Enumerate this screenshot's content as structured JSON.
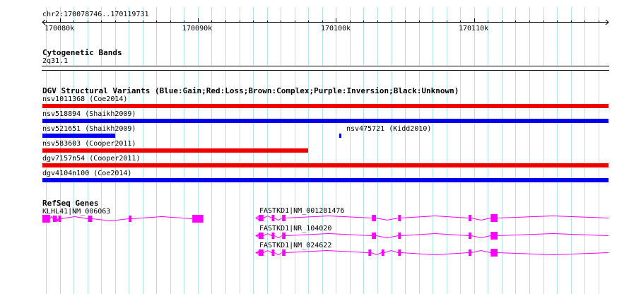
{
  "locus": "chr2:170078746..170119731",
  "ruler": {
    "start": 170078746,
    "end": 170119731,
    "ticks": [
      "170080k",
      "170090k",
      "170100k",
      "170110k"
    ],
    "tick_values": [
      170080000,
      170090000,
      170100000,
      170110000
    ]
  },
  "cytoband": {
    "title": "Cytogenetic Bands",
    "band": "2q31.1"
  },
  "dgv": {
    "title": "DGV Structural Variants (Blue:Gain;Red:Loss;Brown:Complex;Purple:Inversion;Black:Unknown)",
    "colors": {
      "gain": "#0000ee",
      "loss": "#ee0000"
    },
    "variants": [
      {
        "label": "nsv1011368 (Coe2014)",
        "type": "loss",
        "start": 170078746,
        "end": 170119731
      },
      {
        "label": "nsv518894 (Shaikh2009)",
        "type": "gain",
        "start": 170078746,
        "end": 170119731
      },
      {
        "label": "nsv521651 (Shaikh2009)",
        "type": "gain",
        "start": 170078746,
        "end": 170084000
      },
      {
        "label": "nsv475721 (Kidd2010)",
        "type": "gain",
        "start": 170100250,
        "end": 170100400
      },
      {
        "label": "nsv583603 (Cooper2011)",
        "type": "loss",
        "start": 170078746,
        "end": 170098000
      },
      {
        "label": "dgv7157n54 (Cooper2011)",
        "type": "loss",
        "start": 170078746,
        "end": 170119731
      },
      {
        "label": "dgv4104n100 (Coe2014)",
        "type": "gain",
        "start": 170078746,
        "end": 170119731
      }
    ]
  },
  "refseq": {
    "title": "RefSeq Genes",
    "color": "#ff00ff",
    "genes": [
      {
        "label": "KLHL41|NM_006063",
        "start": 170078746,
        "end": 170090400,
        "exons": [
          [
            170078746,
            170079300
          ],
          [
            170079500,
            170079800
          ],
          [
            170079900,
            170080100
          ],
          [
            170082050,
            170082350
          ],
          [
            170085000,
            170085200
          ],
          [
            170089600,
            170090400
          ]
        ]
      },
      {
        "label": "FASTKD1|NM_001281476",
        "start": 170094200,
        "end": 170119731,
        "exons": [
          [
            170094400,
            170094750
          ],
          [
            170095350,
            170095550
          ],
          [
            170096100,
            170096350
          ],
          [
            170102600,
            170102900
          ],
          [
            170104500,
            170104700
          ],
          [
            170109600,
            170109800
          ],
          [
            170111200,
            170111700
          ]
        ]
      },
      {
        "label": "FASTKD1|NR_104020",
        "start": 170094200,
        "end": 170119731,
        "exons": [
          [
            170094400,
            170094750
          ],
          [
            170095350,
            170095550
          ],
          [
            170096100,
            170096350
          ],
          [
            170102600,
            170102900
          ],
          [
            170104500,
            170104700
          ],
          [
            170109600,
            170109800
          ],
          [
            170111200,
            170111700
          ]
        ]
      },
      {
        "label": "FASTKD1|NM_024622",
        "start": 170094200,
        "end": 170119731,
        "exons": [
          [
            170094400,
            170094750
          ],
          [
            170095350,
            170095550
          ],
          [
            170096100,
            170096350
          ],
          [
            170102350,
            170102550
          ],
          [
            170103300,
            170103500
          ],
          [
            170104500,
            170104700
          ],
          [
            170109600,
            170109800
          ],
          [
            170111200,
            170111700
          ]
        ]
      }
    ]
  }
}
